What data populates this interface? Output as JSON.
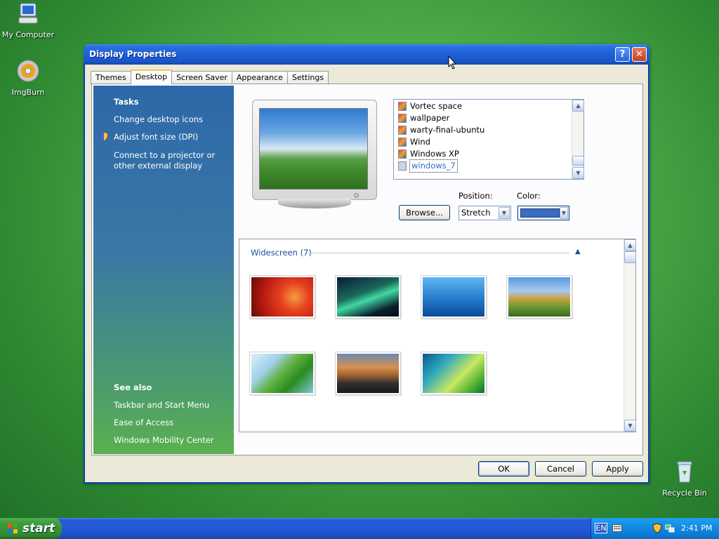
{
  "desktop": {
    "icons": [
      {
        "label": "My Computer",
        "icon": "my-computer-icon"
      },
      {
        "label": "ImgBurn",
        "icon": "imgburn-icon"
      },
      {
        "label": "Recycle Bin",
        "icon": "recycle-bin-icon"
      }
    ]
  },
  "window": {
    "title": "Display Properties",
    "help_label": "?",
    "close_label": "✕",
    "tabs": [
      "Themes",
      "Desktop",
      "Screen Saver",
      "Appearance",
      "Settings"
    ],
    "active_tab": "Desktop"
  },
  "taskpane": {
    "tasks_heading": "Tasks",
    "tasks": [
      "Change desktop icons",
      "Adjust font size (DPI)",
      "Connect to a projector or other external display"
    ],
    "see_also_heading": "See also",
    "see_also": [
      "Taskbar and Start Menu",
      "Ease of Access",
      "Windows Mobility Center"
    ]
  },
  "background_list": {
    "items": [
      "Vortec space",
      "wallpaper",
      "warty-final-ubuntu",
      "Wind",
      "Windows XP",
      "windows_7"
    ],
    "selected": "windows_7"
  },
  "controls": {
    "browse_label": "Browse...",
    "position_label": "Position:",
    "position_value": "Stretch",
    "color_label": "Color:",
    "color_value": "#3a6cbf"
  },
  "gallery": {
    "group_label": "Widescreen (7)",
    "collapse_glyph": "▲",
    "thumbnails": [
      "red-flower",
      "aurora",
      "fish-underwater",
      "green-hills",
      "palm-leaf",
      "rocky-lake",
      "vista-aurora"
    ]
  },
  "dialog_buttons": {
    "ok": "OK",
    "cancel": "Cancel",
    "apply": "Apply"
  },
  "taskbar": {
    "start_label": "start",
    "language": "EN",
    "clock": "2:41 PM"
  }
}
